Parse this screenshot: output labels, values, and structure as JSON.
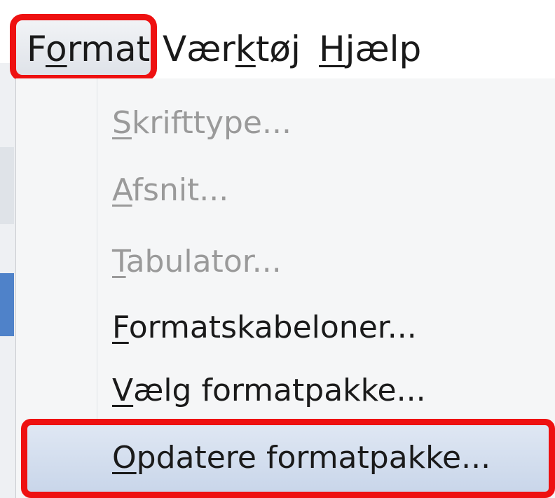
{
  "menubar": {
    "items": [
      {
        "pre": "F",
        "u": "o",
        "post": "rmat"
      },
      {
        "pre": "Vær",
        "u": "k",
        "post": "tøj"
      },
      {
        "pre": "",
        "u": "H",
        "post": "jælp"
      }
    ]
  },
  "dropdown": {
    "items": [
      {
        "pre": "",
        "u": "S",
        "post": "krifttype...",
        "enabled": false
      },
      {
        "pre": "",
        "u": "A",
        "post": "fsnit...",
        "enabled": false
      },
      {
        "pre": "",
        "u": "T",
        "post": "abulator...",
        "enabled": false
      },
      {
        "pre": "",
        "u": "F",
        "post": "ormatskabeloner...",
        "enabled": true
      },
      {
        "pre": "",
        "u": "V",
        "post": "ælg formatpakke...",
        "enabled": true
      },
      {
        "pre": "",
        "u": "O",
        "post": "pdatere formatpakke...",
        "enabled": true
      }
    ]
  },
  "colors": {
    "highlight_border": "#ee1111",
    "disabled_text": "#9a9a9a",
    "enabled_text": "#1a1a1a"
  }
}
